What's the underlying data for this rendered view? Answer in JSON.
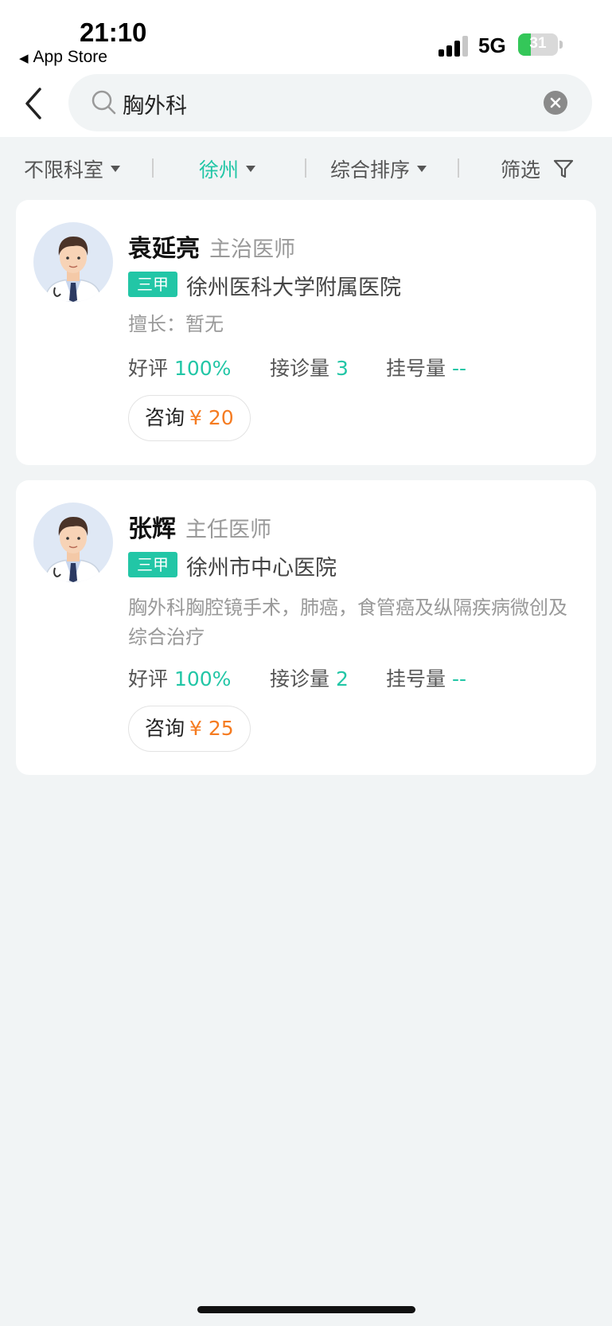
{
  "status_bar": {
    "time": "21:10",
    "back_app": "App Store",
    "network": "5G",
    "battery_level": "31",
    "battery_fraction": 0.31
  },
  "search": {
    "query": "胸外科"
  },
  "filters": [
    {
      "label": "不限科室"
    },
    {
      "label": "徐州"
    },
    {
      "label": "综合排序"
    },
    {
      "label": "筛选"
    }
  ],
  "colors": {
    "accent": "#22c6a6",
    "price": "#f57b20",
    "background": "#f1f4f5"
  },
  "doctors": [
    {
      "name": "袁延亮",
      "title": "主治医师",
      "grade": "三甲",
      "hospital": "徐州医科大学附属医院",
      "expertise": "擅长：暂无",
      "rating_label": "好评",
      "rating": "100%",
      "consults_label": "接诊量",
      "consults": "3",
      "registrations_label": "挂号量",
      "registrations": "--",
      "consult_label": "咨询",
      "price": "¥ 20"
    },
    {
      "name": "张辉",
      "title": "主任医师",
      "grade": "三甲",
      "hospital": "徐州市中心医院",
      "expertise": "胸外科胸腔镜手术，肺癌，食管癌及纵隔疾病微创及综合治疗",
      "rating_label": "好评",
      "rating": "100%",
      "consults_label": "接诊量",
      "consults": "2",
      "registrations_label": "挂号量",
      "registrations": "--",
      "consult_label": "咨询",
      "price": "¥ 25"
    }
  ]
}
